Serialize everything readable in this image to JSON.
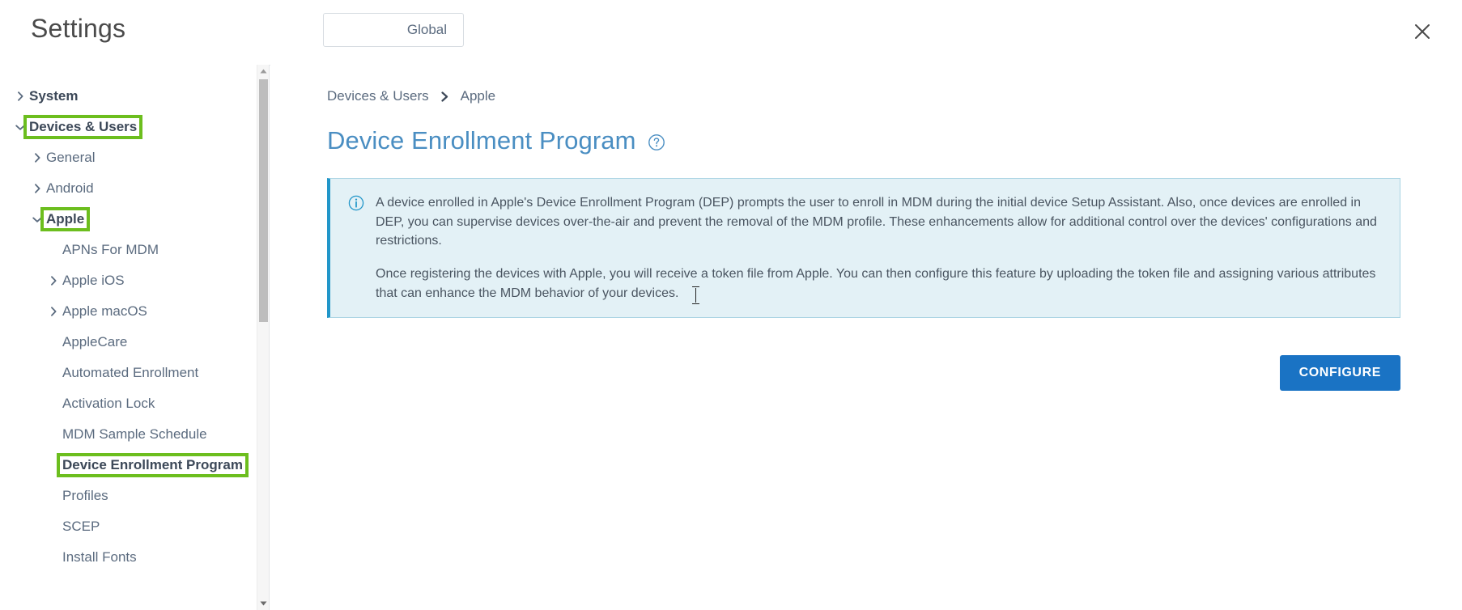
{
  "header": {
    "title": "Settings",
    "scope_button_label": "Global",
    "close_label": "Close"
  },
  "sidebar": {
    "items": [
      {
        "label": "System",
        "level": 0,
        "caret": "chevron-right",
        "top_level": true,
        "highlighted": false
      },
      {
        "label": "Devices & Users",
        "level": 0,
        "caret": "chevron-down",
        "top_level": true,
        "highlighted": true
      },
      {
        "label": "General",
        "level": 1,
        "caret": "chevron-right",
        "top_level": false,
        "highlighted": false
      },
      {
        "label": "Android",
        "level": 1,
        "caret": "chevron-right",
        "top_level": false,
        "highlighted": false
      },
      {
        "label": "Apple",
        "level": 1,
        "caret": "chevron-down",
        "top_level": true,
        "highlighted": true
      },
      {
        "label": "APNs For MDM",
        "level": 2,
        "caret": "none",
        "top_level": false,
        "highlighted": false
      },
      {
        "label": "Apple iOS",
        "level": 2,
        "caret": "chevron-right",
        "top_level": false,
        "highlighted": false
      },
      {
        "label": "Apple macOS",
        "level": 2,
        "caret": "chevron-right",
        "top_level": false,
        "highlighted": false
      },
      {
        "label": "AppleCare",
        "level": 2,
        "caret": "none",
        "top_level": false,
        "highlighted": false
      },
      {
        "label": "Automated Enrollment",
        "level": 2,
        "caret": "none",
        "top_level": false,
        "highlighted": false
      },
      {
        "label": "Activation Lock",
        "level": 2,
        "caret": "none",
        "top_level": false,
        "highlighted": false
      },
      {
        "label": "MDM Sample Schedule",
        "level": 2,
        "caret": "none",
        "top_level": false,
        "highlighted": false
      },
      {
        "label": "Device Enrollment Program",
        "level": 2,
        "caret": "none",
        "top_level": false,
        "highlighted": true
      },
      {
        "label": "Profiles",
        "level": 2,
        "caret": "none",
        "top_level": false,
        "highlighted": false
      },
      {
        "label": "SCEP",
        "level": 2,
        "caret": "none",
        "top_level": false,
        "highlighted": false
      },
      {
        "label": "Install Fonts",
        "level": 2,
        "caret": "none",
        "top_level": false,
        "highlighted": false
      }
    ]
  },
  "main": {
    "breadcrumb": [
      {
        "label": "Devices & Users"
      },
      {
        "label": "Apple"
      }
    ],
    "title": "Device Enrollment Program",
    "info_banner": {
      "paragraph_1": "A device enrolled in Apple's Device Enrollment Program (DEP) prompts the user to enroll in MDM during the initial device Setup Assistant. Also, once devices are enrolled in DEP, you can supervise devices over-the-air and prevent the removal of the MDM profile. These enhancements allow for additional control over the devices' configurations and restrictions.",
      "paragraph_2": "Once registering the devices with Apple, you will receive a token file from Apple. You can then configure this feature by uploading the token file and assigning various attributes that can enhance the MDM behavior of your devices."
    },
    "configure_button_label": "CONFIGURE"
  },
  "colors": {
    "accent_blue": "#1a73c4",
    "title_blue": "#4a8ec2",
    "highlight_green": "#6cbe1e",
    "info_bg": "#e3f1f6",
    "info_border": "#2196c9"
  }
}
